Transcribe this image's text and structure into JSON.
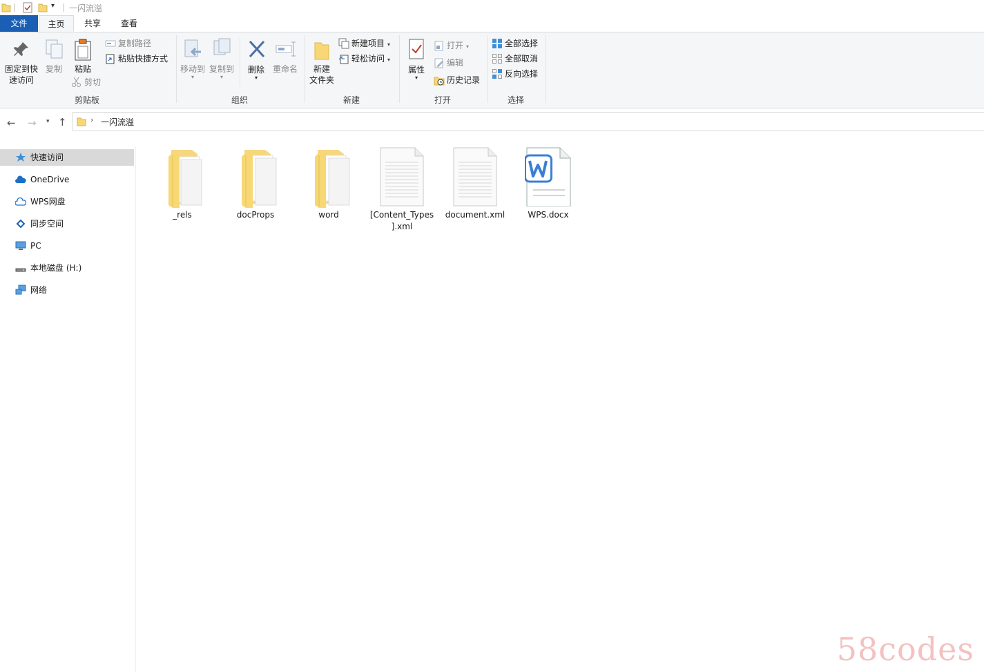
{
  "window": {
    "title": "一闪流溢"
  },
  "tabs": {
    "file": "文件",
    "home": "主页",
    "share": "共享",
    "view": "查看"
  },
  "ribbon": {
    "clipboard": {
      "label": "剪贴板",
      "pin_line1": "固定到快",
      "pin_line2": "速访问",
      "copy": "复制",
      "paste": "粘贴",
      "copy_path": "复制路径",
      "paste_shortcut": "粘贴快捷方式",
      "cut": "剪切"
    },
    "organize": {
      "label": "组织",
      "move_to": "移动到",
      "copy_to": "复制到",
      "delete": "删除",
      "rename": "重命名"
    },
    "new": {
      "label": "新建",
      "new_folder_line1": "新建",
      "new_folder_line2": "文件夹",
      "new_item": "新建项目",
      "easy_access": "轻松访问"
    },
    "open": {
      "label": "打开",
      "properties": "属性",
      "open": "打开",
      "edit": "编辑",
      "history": "历史记录"
    },
    "select": {
      "label": "选择",
      "select_all": "全部选择",
      "select_none": "全部取消",
      "invert": "反向选择"
    }
  },
  "address": {
    "path": "一闪流溢"
  },
  "sidebar": {
    "items": [
      {
        "label": "快速访问"
      },
      {
        "label": "OneDrive"
      },
      {
        "label": "WPS网盘"
      },
      {
        "label": "同步空间"
      },
      {
        "label": "PC"
      },
      {
        "label": "本地磁盘 (H:)"
      },
      {
        "label": "网络"
      }
    ]
  },
  "files": [
    {
      "name": "_rels",
      "type": "folder"
    },
    {
      "name": "docProps",
      "type": "folder"
    },
    {
      "name": "word",
      "type": "folder"
    },
    {
      "name_line1": "[Content_Types",
      "name_line2": "].xml",
      "type": "xml"
    },
    {
      "name": "document.xml",
      "type": "xml"
    },
    {
      "name": "WPS.docx",
      "type": "docx"
    }
  ],
  "watermark": "58codes",
  "colors": {
    "accent": "#1a5fb4",
    "folder": "#f8d775",
    "selected": "#d9d9d9"
  }
}
